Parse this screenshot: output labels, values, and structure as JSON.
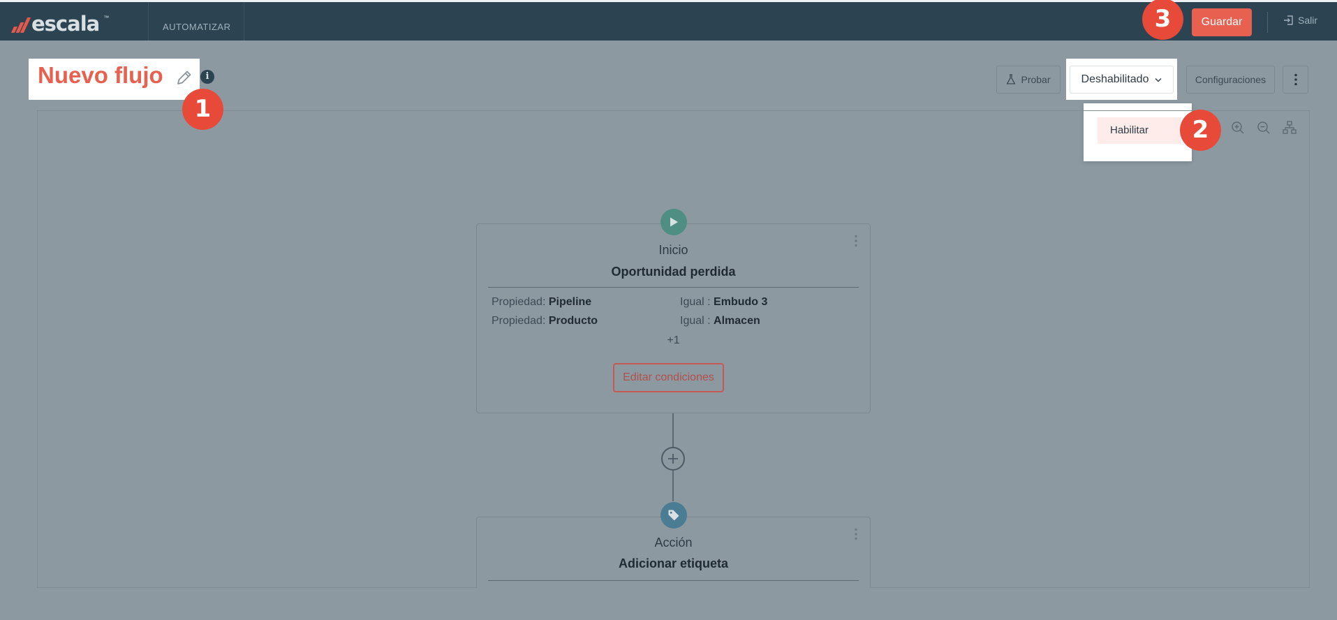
{
  "app": {
    "logo_text": "escala",
    "logo_tm": "™",
    "section": "AUTOMATIZAR",
    "save_label": "Guardar",
    "exit_label": "Salir"
  },
  "flow": {
    "title": "Nuevo flujo",
    "test_label": "Probar",
    "status_value": "Deshabilitado",
    "status_options": [
      "Habilitar"
    ],
    "config_label": "Configuraciones"
  },
  "nodes": {
    "start": {
      "kind": "Inicio",
      "name": "Oportunidad perdida",
      "conditions": [
        {
          "prop_prefix": "Propiedad:",
          "prop": "Pipeline",
          "op": "Igual :",
          "value": "Embudo 3"
        },
        {
          "prop_prefix": "Propiedad:",
          "prop": "Producto",
          "op": "Igual :",
          "value": "Almacen"
        }
      ],
      "more": "+1",
      "edit_label": "Editar condiciones"
    },
    "action": {
      "kind": "Acción",
      "name": "Adicionar etiqueta"
    }
  },
  "markers": [
    "1",
    "2",
    "3"
  ],
  "colors": {
    "topbar": "#2c4452",
    "accent": "#e8604f",
    "overlay": "#8c99a1",
    "marker": "#e84a3a"
  },
  "icons": [
    "edit-icon",
    "info-icon",
    "flask-icon",
    "chevron-down-icon",
    "more-vertical-icon",
    "zoom-in-icon",
    "zoom-out-icon",
    "layout-tree-icon",
    "play-icon",
    "tag-icon",
    "plus-circle-icon",
    "exit-icon"
  ]
}
